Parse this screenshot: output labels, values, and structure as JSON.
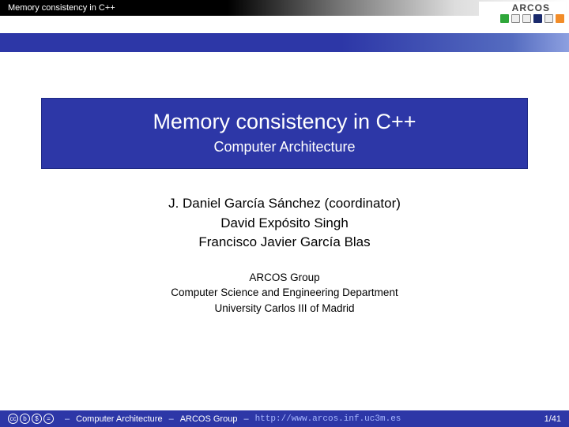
{
  "topbar": {
    "title": "Memory consistency in C++"
  },
  "logo": {
    "text": "ARCOS"
  },
  "title": {
    "main": "Memory consistency in C++",
    "sub": "Computer Architecture"
  },
  "authors": {
    "a1": "J. Daniel García Sánchez (coordinator)",
    "a2": "David Expósito Singh",
    "a3": "Francisco Javier García Blas"
  },
  "affil": {
    "l1": "ARCOS Group",
    "l2": "Computer Science and Engineering Department",
    "l3": "University Carlos III of Madrid"
  },
  "footer": {
    "course": "Computer Architecture",
    "group": "ARCOS Group",
    "url": "http://www.arcos.inf.uc3m.es",
    "page": "1/41",
    "sep": "–"
  }
}
